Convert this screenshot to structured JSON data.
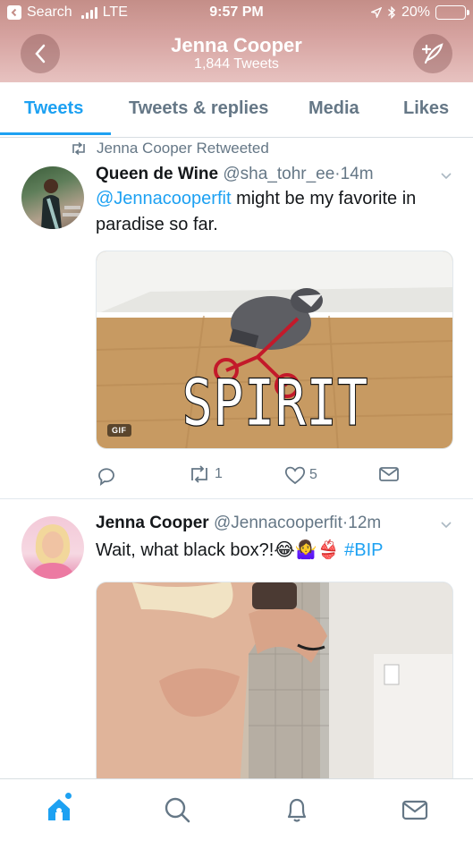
{
  "status_bar": {
    "back_app": "Search",
    "carrier": "LTE",
    "time": "9:57 PM",
    "battery": "20%",
    "battery_level": 0.2
  },
  "nav": {
    "title": "Jenna Cooper",
    "subtitle": "1,844 Tweets"
  },
  "tabs": [
    {
      "label": "Tweets",
      "active": true
    },
    {
      "label": "Tweets & replies",
      "active": false
    },
    {
      "label": "Media",
      "active": false
    },
    {
      "label": "Likes",
      "active": false
    }
  ],
  "tweets": [
    {
      "retweet_note": "Jenna Cooper Retweeted",
      "name": "Queen de Wine",
      "handle": "@sha_tohr_ee",
      "separator": "·",
      "time": "14m",
      "mention": "@Jennacooperfit",
      "text": " might be my favorite in paradise so far.",
      "media_caption": "SPIRIT ANIMAL",
      "media_badge": "GIF",
      "retweets": "1",
      "likes": "5"
    },
    {
      "name": "Jenna Cooper",
      "handle": "@Jennacooperfit",
      "separator": "·",
      "time": "12m",
      "text": "Wait, what black box?!",
      "emoji": "😂🤷‍♀️👙",
      "hashtag": "#BIP"
    }
  ],
  "colors": {
    "accent": "#1da1f2",
    "header": "#d6a3a0",
    "secondary_text": "#657786"
  },
  "icons": {
    "bottom_bar": [
      "home-icon",
      "search-icon",
      "notifications-icon",
      "messages-icon"
    ]
  }
}
